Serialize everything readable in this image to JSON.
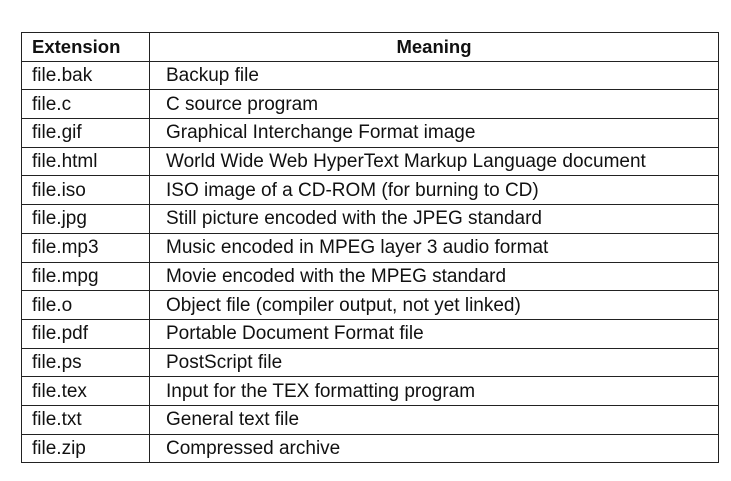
{
  "table": {
    "headers": [
      "Extension",
      "Meaning"
    ],
    "rows": [
      [
        "file.bak",
        "Backup file"
      ],
      [
        "file.c",
        "C source program"
      ],
      [
        "file.gif",
        "Graphical Interchange Format image"
      ],
      [
        "file.html",
        "World Wide Web HyperText Markup Language document"
      ],
      [
        "file.iso",
        "ISO image of a CD-ROM (for burning to CD)"
      ],
      [
        "file.jpg",
        "Still picture encoded with the JPEG standard"
      ],
      [
        "file.mp3",
        "Music encoded in MPEG layer 3 audio format"
      ],
      [
        "file.mpg",
        "Movie encoded with the MPEG standard"
      ],
      [
        "file.o",
        "Object file (compiler output, not yet linked)"
      ],
      [
        "file.pdf",
        "Portable Document Format file"
      ],
      [
        "file.ps",
        "PostScript file"
      ],
      [
        "file.tex",
        "Input for the TEX formatting program"
      ],
      [
        "file.txt",
        "General text file"
      ],
      [
        "file.zip",
        "Compressed archive"
      ]
    ]
  }
}
